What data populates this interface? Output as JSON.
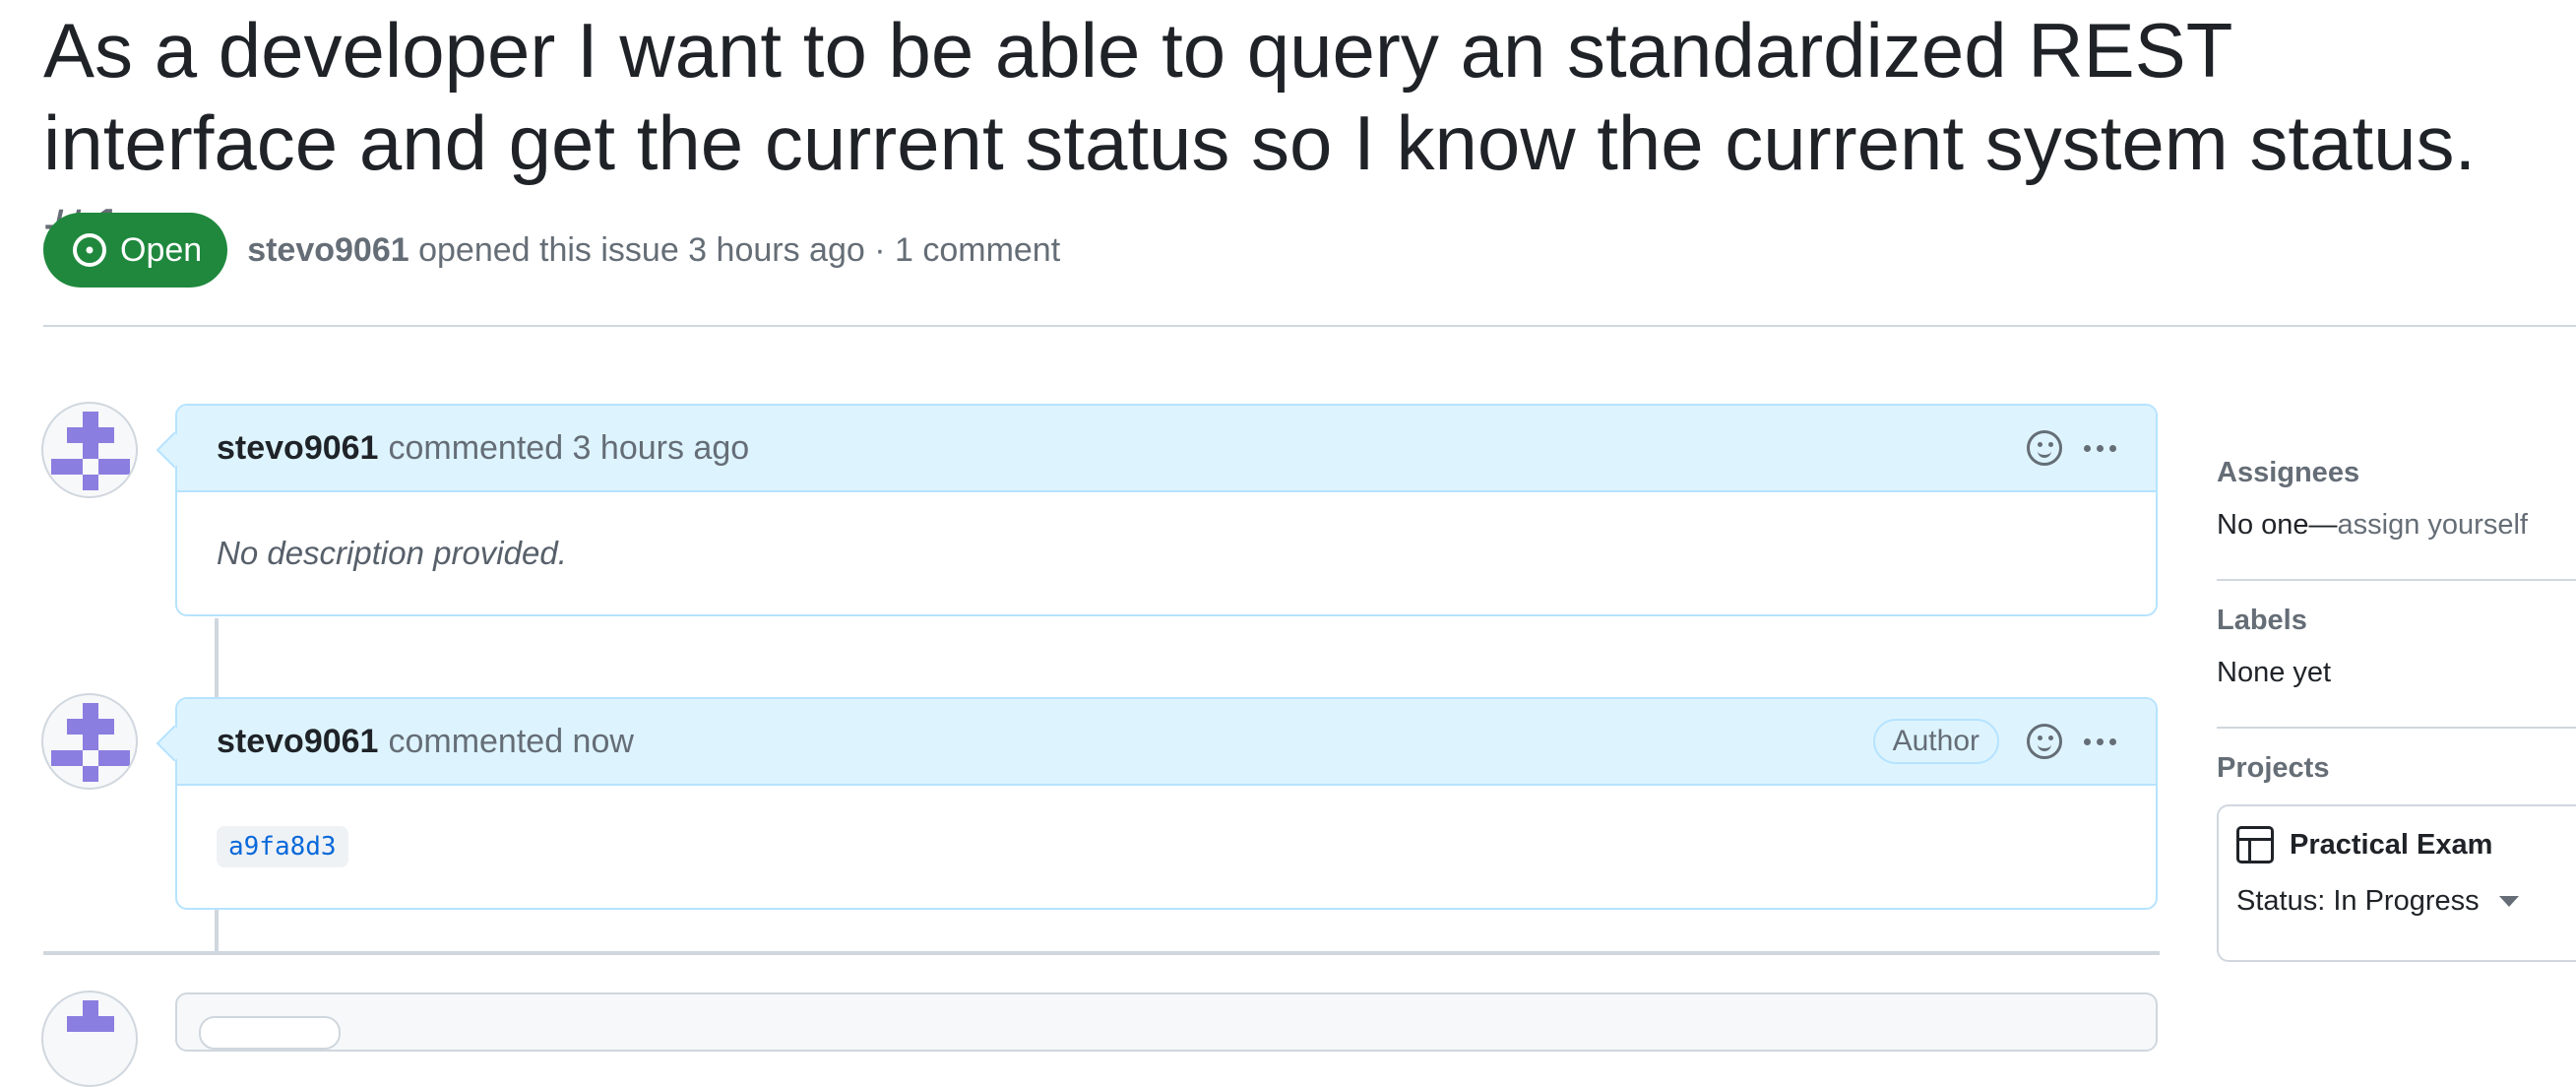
{
  "issue": {
    "title": "As a developer I want to be able to query an standardized REST interface and get the current status so I know the current system status.",
    "number": "#1",
    "state_label": "Open",
    "author": "stevo9061",
    "meta_suffix": "opened this issue 3 hours ago · 1 comment",
    "state_color": "#1f883d"
  },
  "comments": [
    {
      "author": "stevo9061",
      "action": "commented 3 hours ago",
      "body": "No description provided.",
      "badge": ""
    },
    {
      "author": "stevo9061",
      "action": "commented now",
      "badge": "Author",
      "commit_ref": "a9fa8d3"
    }
  ],
  "sidebar": {
    "assignees": {
      "heading": "Assignees",
      "value_prefix": "No one—",
      "value_link": "assign yourself"
    },
    "labels": {
      "heading": "Labels",
      "value": "None yet"
    },
    "projects": {
      "heading": "Projects",
      "project_name": "Practical Exam",
      "status": "Status: In Progress"
    }
  },
  "icons": {
    "state": "issue-opened-icon",
    "reaction": "smiley-icon",
    "more": "kebab-horizontal-icon",
    "project": "table-icon",
    "dropdown": "triangle-down-icon"
  },
  "colors": {
    "comment_header_bg": "#ddf4ff",
    "comment_border": "#b6e3ff",
    "link": "#0969da"
  }
}
